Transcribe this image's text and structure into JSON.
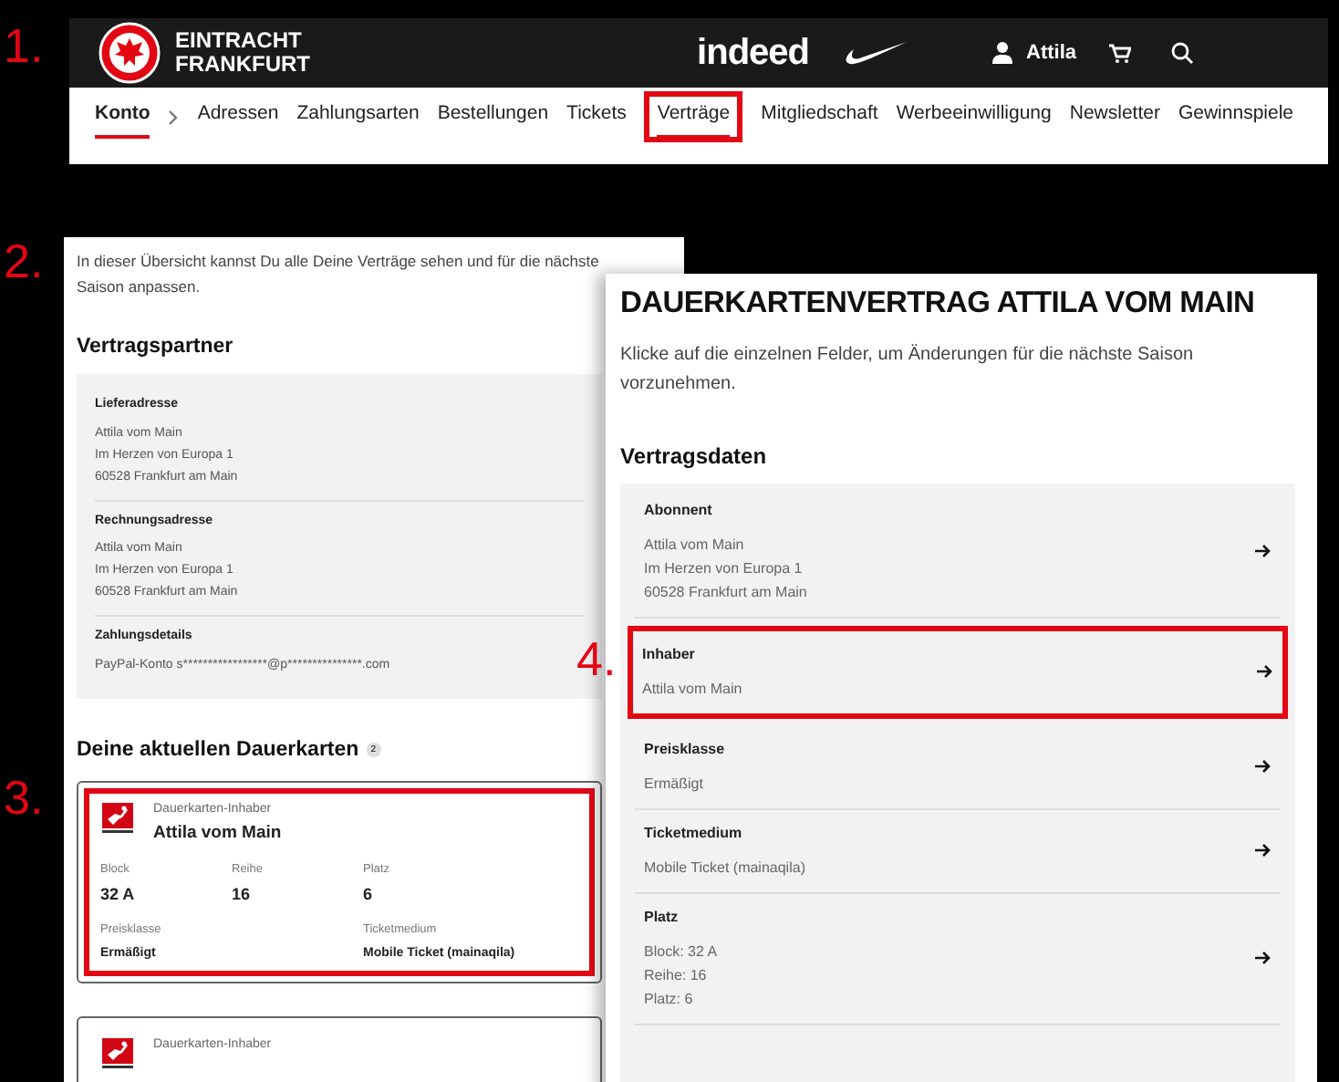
{
  "account_header": {
    "step": "1.",
    "brand_lines": [
      "EINTRACHT",
      "FRANKFURT"
    ],
    "sponsor": "indeed",
    "user": "Attila",
    "nav": [
      {
        "label": "Konto",
        "selected": true,
        "highlighted": false
      },
      {
        "label": "Adressen",
        "selected": false,
        "highlighted": false
      },
      {
        "label": "Zahlungsarten",
        "selected": false,
        "highlighted": false
      },
      {
        "label": "Bestellungen",
        "selected": false,
        "highlighted": false
      },
      {
        "label": "Tickets",
        "selected": false,
        "highlighted": false
      },
      {
        "label": "Verträge",
        "selected": true,
        "highlighted": true
      },
      {
        "label": "Mitgliedschaft",
        "selected": false,
        "highlighted": false
      },
      {
        "label": "Werbeeinwilligung",
        "selected": false,
        "highlighted": false
      },
      {
        "label": "Newsletter",
        "selected": false,
        "highlighted": false
      },
      {
        "label": "Gewinnspiele",
        "selected": false,
        "highlighted": false
      }
    ]
  },
  "overview": {
    "step": "2.",
    "intro": "In dieser Übersicht kannst Du alle Deine Verträge sehen und für die nächste Saison anpassen.",
    "partner_title": "Vertragspartner",
    "partner_sections": [
      {
        "title": "Lieferadresse",
        "lines": [
          "Attila vom Main",
          "Im Herzen von Europa 1",
          "60528 Frankfurt am Main"
        ]
      },
      {
        "title": "Rechnungsadresse",
        "lines": [
          "Attila vom Main",
          "Im Herzen von Europa 1",
          "60528 Frankfurt am Main"
        ]
      },
      {
        "title": "Zahlungsdetails",
        "lines": [
          "PayPal-Konto s*****************@p***************.com"
        ]
      }
    ],
    "cards_step": "3.",
    "cards_title": "Deine aktuellen Dauerkarten",
    "cards_count": "2",
    "cards": [
      {
        "highlighted": true,
        "holder_label": "Dauerkarten-Inhaber",
        "holder": "Attila vom Main",
        "seat_fields": [
          {
            "label": "Block",
            "value": "32 A"
          },
          {
            "label": "Reihe",
            "value": "16"
          },
          {
            "label": "Platz",
            "value": "6"
          }
        ],
        "detail_fields": [
          {
            "label": "Preisklasse",
            "value": "Ermäßigt"
          },
          {
            "label": "Ticketmedium",
            "value": "Mobile Ticket (mainaqila)"
          }
        ]
      },
      {
        "highlighted": false,
        "holder_label": "Dauerkarten-Inhaber"
      }
    ]
  },
  "detail": {
    "step": "4.",
    "title": "DAUERKARTENVERTRAG ATTILA VOM MAIN",
    "intro": "Klicke auf die einzelnen Felder, um Änderungen für die nächste Saison vorzunehmen.",
    "section_title": "Vertragsdaten",
    "rows": [
      {
        "label": "Abonnent",
        "lines": [
          "Attila vom Main",
          "Im Herzen von Europa 1",
          "60528 Frankfurt am Main"
        ],
        "highlighted": false
      },
      {
        "label": "Inhaber",
        "lines": [
          "Attila vom Main"
        ],
        "highlighted": true
      },
      {
        "label": "Preisklasse",
        "lines": [
          "Ermäßigt"
        ],
        "highlighted": false
      },
      {
        "label": "Ticketmedium",
        "lines": [
          "Mobile Ticket (mainaqila)"
        ],
        "highlighted": false
      },
      {
        "label": "Platz",
        "lines": [
          "Block: 32 A",
          "Reihe: 16",
          "Platz: 6"
        ],
        "highlighted": false
      }
    ]
  }
}
